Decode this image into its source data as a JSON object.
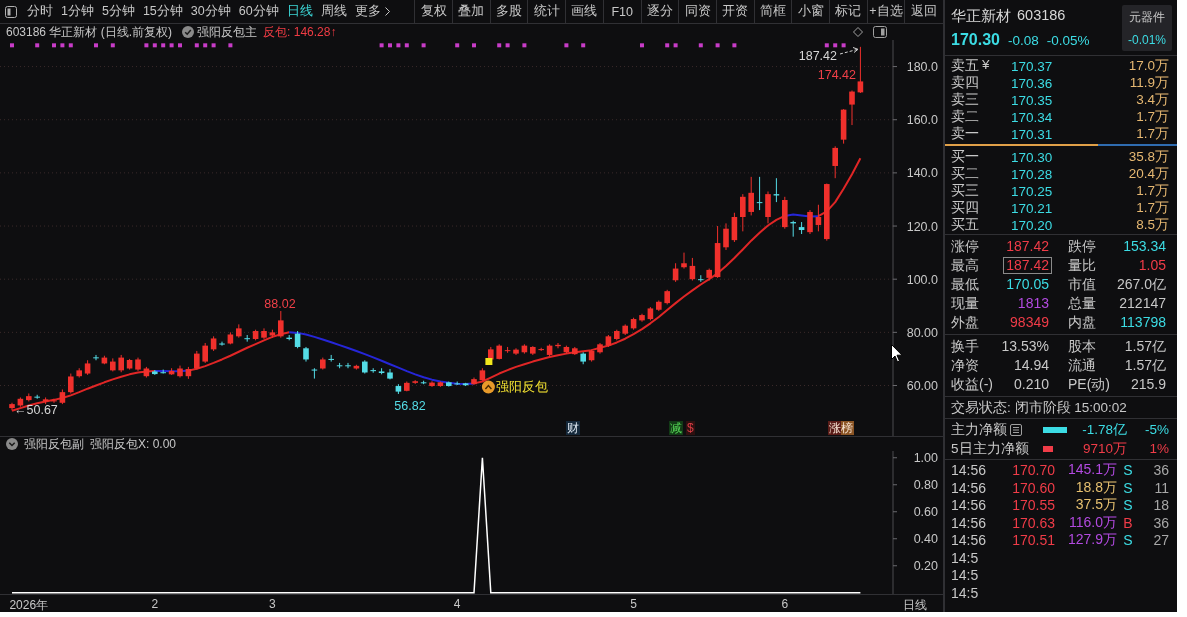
{
  "toolbar": {
    "periods": [
      {
        "label": "分时",
        "selected": false
      },
      {
        "label": "1分钟",
        "selected": false
      },
      {
        "label": "5分钟",
        "selected": false
      },
      {
        "label": "15分钟",
        "selected": false
      },
      {
        "label": "30分钟",
        "selected": false
      },
      {
        "label": "60分钟",
        "selected": false
      },
      {
        "label": "日线",
        "selected": true
      },
      {
        "label": "周线",
        "selected": false
      }
    ],
    "more_label": "更多",
    "actions": [
      "复权",
      "叠加",
      "多股",
      "统计",
      "画线",
      "F10",
      "逐分",
      "同资",
      "开资",
      "简框",
      "小窗",
      "标记",
      "+自选",
      "返回"
    ]
  },
  "chart_header": {
    "title": "603186 华正新材 (日线.前复权)",
    "indicator": "强阳反包主",
    "reading": "反包: 146.28↑"
  },
  "price_pane": {
    "chart_data": [
      {
        "type": "candlestick",
        "ylim": [
          41,
          190
        ],
        "yticks": [
          {
            "value": 60,
            "label": "60.00"
          },
          {
            "value": 80,
            "label": "80.00"
          },
          {
            "value": 100,
            "label": "100.0"
          },
          {
            "value": 120,
            "label": "120.0"
          },
          {
            "value": 140,
            "label": "140.0"
          },
          {
            "value": 160,
            "label": "160.0"
          },
          {
            "value": 180,
            "label": "180.0"
          }
        ],
        "tick_labels": "y",
        "grid": true,
        "ohlc": [
          [
            51.5,
            53.5,
            50.67,
            53
          ],
          [
            52.5,
            55.5,
            52,
            55
          ],
          [
            54.5,
            57,
            54,
            56
          ],
          [
            55.8,
            56.5,
            55,
            55.5
          ],
          [
            54,
            55.5,
            53,
            54.8
          ],
          [
            54.2,
            55,
            53.5,
            54.4
          ],
          [
            53.5,
            58.5,
            53,
            57.5
          ],
          [
            57.5,
            64.5,
            57,
            63.4
          ],
          [
            63.5,
            66.5,
            63,
            65.7
          ],
          [
            64.5,
            69.5,
            64,
            68.3
          ],
          [
            70.6,
            71.5,
            69.5,
            70.3
          ],
          [
            68.3,
            71.2,
            68,
            70.5
          ],
          [
            65.7,
            70.2,
            65.3,
            69
          ],
          [
            65.7,
            71.5,
            65,
            70.5
          ],
          [
            66.4,
            70,
            66,
            69.6
          ],
          [
            66,
            70.5,
            65.5,
            69.8
          ],
          [
            63.5,
            67,
            63,
            66.4
          ],
          [
            65.3,
            65.8,
            64,
            64.3
          ],
          [
            65,
            66,
            64.5,
            64.8
          ],
          [
            64.2,
            66.5,
            64,
            65.5
          ],
          [
            63.5,
            67.5,
            63,
            66.4
          ],
          [
            63.5,
            67,
            62.5,
            66.2
          ],
          [
            66.4,
            73,
            66,
            72
          ],
          [
            69,
            76,
            68.5,
            75
          ],
          [
            73.6,
            78.5,
            73,
            77.7
          ],
          [
            75.8,
            76.5,
            75,
            75.4
          ],
          [
            75.8,
            80,
            75.5,
            79.2
          ],
          [
            78.5,
            83,
            78,
            81.5
          ],
          [
            77.8,
            79,
            76.5,
            77.5
          ],
          [
            77.5,
            81,
            77,
            80.5
          ],
          [
            78,
            81.5,
            77.5,
            80.5
          ],
          [
            78.8,
            81,
            78,
            80
          ],
          [
            78.5,
            88.02,
            78,
            84.5
          ],
          [
            78,
            79,
            77,
            77.5
          ],
          [
            79.5,
            80.5,
            74,
            74.5
          ],
          [
            74,
            74.5,
            69,
            69.8
          ],
          [
            66,
            66.5,
            62.6,
            65.7
          ],
          [
            66.4,
            70.5,
            66,
            69.8
          ],
          [
            70,
            71.5,
            69,
            69.8
          ],
          [
            67.6,
            68.5,
            66.5,
            67.4
          ],
          [
            67.6,
            68.5,
            66.5,
            67.4
          ],
          [
            66.4,
            67.8,
            66,
            67.4
          ],
          [
            69,
            69.5,
            64.5,
            64.9
          ],
          [
            65.8,
            66.5,
            64.8,
            65.4
          ],
          [
            65.3,
            66.5,
            64.2,
            64.7
          ],
          [
            64.9,
            66.2,
            62.3,
            62.6
          ],
          [
            59.8,
            60.5,
            56.82,
            57.7
          ],
          [
            58,
            61.5,
            57.8,
            61
          ],
          [
            61,
            62,
            60.6,
            61.6
          ],
          [
            61.2,
            61.8,
            60.5,
            61
          ],
          [
            59.8,
            61.6,
            59.5,
            61.1
          ],
          [
            59.8,
            61.5,
            59.5,
            61.2
          ],
          [
            61.2,
            61.5,
            59.6,
            59.8
          ],
          [
            60.8,
            61.5,
            60.2,
            60.7
          ],
          [
            60.8,
            61,
            59.8,
            60.1
          ],
          [
            60.5,
            63,
            60.3,
            62.4
          ],
          [
            62,
            66.5,
            61.8,
            65.7
          ],
          [
            69.8,
            74.5,
            69.5,
            73.6
          ],
          [
            70,
            75.5,
            69.8,
            75
          ],
          [
            73,
            74.5,
            72.3,
            73.3
          ],
          [
            72,
            74,
            71.5,
            73.5
          ],
          [
            72.5,
            75.5,
            72,
            75
          ],
          [
            72,
            74.8,
            71.5,
            74.5
          ],
          [
            73.5,
            74.2,
            73,
            73.7
          ],
          [
            71.5,
            75.5,
            71,
            75
          ],
          [
            74.8,
            76,
            74,
            75.3
          ],
          [
            72.5,
            75,
            72,
            74.5
          ],
          [
            71.8,
            74.5,
            71.5,
            74
          ],
          [
            72,
            72.5,
            68,
            69
          ],
          [
            69.5,
            73.5,
            69,
            73
          ],
          [
            72.5,
            76,
            72,
            75.5
          ],
          [
            75,
            79,
            74.5,
            78.5
          ],
          [
            77.5,
            81,
            77,
            80.5
          ],
          [
            79.5,
            83,
            79,
            82.5
          ],
          [
            81.5,
            85.5,
            81,
            85
          ],
          [
            84.5,
            87,
            84,
            86.5
          ],
          [
            85,
            89.5,
            84.5,
            89
          ],
          [
            88.5,
            92,
            88,
            91.5
          ],
          [
            91,
            96,
            90.5,
            95.5
          ],
          [
            99.6,
            106,
            99,
            104
          ],
          [
            104.5,
            110,
            104,
            106
          ],
          [
            100,
            108,
            99.5,
            105
          ],
          [
            100,
            101.5,
            99,
            99.8
          ],
          [
            100.5,
            104,
            99.5,
            103.5
          ],
          [
            100.8,
            120,
            100.5,
            113.6
          ],
          [
            112,
            121,
            111,
            119
          ],
          [
            114.7,
            125,
            114,
            123.4
          ],
          [
            123.4,
            132,
            118,
            131
          ],
          [
            125.3,
            138.5,
            124,
            132.5
          ],
          [
            129,
            138.5,
            126,
            128.7
          ],
          [
            123.4,
            133,
            121,
            132
          ],
          [
            132,
            138,
            129,
            131.5
          ],
          [
            119.6,
            131,
            119,
            129.8
          ],
          [
            121.5,
            122,
            116,
            121
          ],
          [
            119.6,
            121.5,
            117,
            118.5
          ],
          [
            117.7,
            126,
            117,
            125.3
          ],
          [
            120.4,
            128,
            118,
            123.4
          ],
          [
            115.1,
            136,
            114.5,
            135.8
          ],
          [
            142.6,
            150,
            138,
            149.4
          ],
          [
            152.5,
            164,
            151,
            163.8
          ],
          [
            165.7,
            171,
            158,
            170.6
          ],
          [
            170.3,
            187.42,
            170.05,
            174.42
          ]
        ],
        "series": [
          {
            "type": "line",
            "color": "#e02626",
            "values": [
              50.5,
              51.5,
              52.5,
              53.3,
              54,
              54.6,
              55.3,
              56.3,
              57.5,
              58.8,
              60,
              61.2,
              62.3,
              63.3,
              64.2,
              64.9,
              65.3,
              65.5,
              null,
              null,
              null,
              65.6,
              66.3,
              67.3,
              68.5,
              69.8,
              71.2,
              72.7,
              74.2,
              75.6,
              77,
              78.3,
              79.3,
              80,
              null,
              null,
              null,
              null,
              null,
              null,
              null,
              null,
              null,
              null,
              null,
              null,
              null,
              null,
              null,
              null,
              null,
              null,
              null,
              null,
              null,
              60.8,
              61.5,
              63,
              64.5,
              65.8,
              67,
              68,
              69,
              69.9,
              70.7,
              71.4,
              72,
              72.5,
              72.9,
              73.3,
              74.2,
              75,
              76.2,
              77.6,
              79.3,
              81.2,
              83.4,
              85.8,
              88.4,
              91,
              93.5,
              95.8,
              98,
              100,
              102.2,
              105,
              108,
              111.2,
              114.5,
              117.5,
              120.2,
              122.3,
              123.8,
              null,
              null,
              null,
              123.7,
              125.5,
              129,
              134,
              139.5,
              145.5
            ]
          },
          {
            "type": "line",
            "color": "#2626d8",
            "values": [
              null,
              null,
              null,
              null,
              null,
              null,
              null,
              null,
              null,
              null,
              null,
              null,
              null,
              null,
              null,
              null,
              null,
              65.5,
              65.5,
              65.4,
              65.4,
              65.6,
              null,
              null,
              null,
              null,
              null,
              null,
              null,
              null,
              null,
              null,
              null,
              80,
              79.8,
              79.2,
              78.3,
              77.3,
              76.3,
              75.2,
              74.1,
              73,
              71.8,
              70.6,
              69.3,
              68,
              66.7,
              65.4,
              64.2,
              63.1,
              62.2,
              61.5,
              61,
              60.7,
              60.6,
              60.8,
              null,
              null,
              null,
              null,
              null,
              null,
              null,
              null,
              null,
              null,
              null,
              null,
              null,
              null,
              null,
              null,
              null,
              null,
              null,
              null,
              null,
              null,
              null,
              null,
              null,
              null,
              null,
              null,
              null,
              null,
              null,
              null,
              null,
              null,
              null,
              null,
              123.8,
              124.3,
              124,
              123.6,
              123.7,
              null,
              null,
              null,
              null,
              null
            ]
          },
          {
            "type": "scatter",
            "marker": "square",
            "color": "#c83cc8",
            "values": [
              188,
              null,
              null,
              188,
              null,
              188,
              188,
              188,
              null,
              null,
              188,
              null,
              188,
              null,
              null,
              null,
              188,
              188,
              188,
              188,
              188,
              null,
              188,
              188,
              188,
              null,
              188,
              null,
              null,
              null,
              null,
              null,
              null,
              null,
              null,
              null,
              null,
              null,
              null,
              null,
              null,
              null,
              null,
              null,
              188,
              188,
              188,
              188,
              null,
              188,
              null,
              null,
              null,
              188,
              null,
              188,
              null,
              null,
              188,
              188,
              null,
              188,
              null,
              null,
              null,
              null,
              188,
              null,
              188,
              null,
              null,
              null,
              null,
              null,
              null,
              188,
              null,
              null,
              188,
              188,
              null,
              null,
              188,
              null,
              188,
              null,
              188,
              null,
              null,
              null,
              null,
              null,
              null,
              null,
              null,
              null,
              null,
              188,
              188,
              188,
              null,
              null
            ]
          }
        ],
        "annotations": [
          "←50.67",
          "88.02",
          "56.82",
          "187.42",
          "174.42"
        ]
      }
    ],
    "signal_label": "强阳反包",
    "events": [
      {
        "label": "财",
        "kind": "finance"
      },
      {
        "label": "减",
        "kind": "reduce"
      },
      {
        "label": "$",
        "kind": "dividend"
      },
      {
        "label": "涨榜",
        "kind": "rank"
      }
    ]
  },
  "indicator_pane": {
    "title": "强阳反包副",
    "reading": "强阳反包X: 0.00",
    "axis_caption": "日线",
    "chart_data": [
      {
        "type": "line",
        "color": "#ffffff",
        "ylim": [
          0,
          1.05
        ],
        "yticks": [
          {
            "value": 0.2,
            "label": "0.20"
          },
          {
            "value": 0.4,
            "label": "0.40"
          },
          {
            "value": 0.6,
            "label": "0.60"
          },
          {
            "value": 0.8,
            "label": "0.80"
          },
          {
            "value": 1,
            "label": "1.00"
          }
        ],
        "categories": [
          null,
          null,
          "2026年",
          null,
          null,
          null,
          null,
          null,
          null,
          null,
          null,
          null,
          null,
          null,
          null,
          null,
          null,
          "2",
          null,
          null,
          null,
          null,
          null,
          null,
          null,
          null,
          null,
          null,
          null,
          null,
          null,
          "3",
          null,
          null,
          null,
          null,
          null,
          null,
          null,
          null,
          null,
          null,
          null,
          null,
          null,
          null,
          null,
          null,
          null,
          null,
          null,
          null,
          null,
          "4",
          null,
          null,
          null,
          null,
          null,
          null,
          null,
          null,
          null,
          null,
          null,
          null,
          null,
          null,
          null,
          null,
          null,
          null,
          null,
          null,
          "5",
          null,
          null,
          null,
          null,
          null,
          null,
          null,
          null,
          null,
          null,
          null,
          null,
          null,
          null,
          null,
          null,
          null,
          "6",
          null,
          null,
          null,
          null,
          null,
          null,
          null,
          null,
          null
        ],
        "values": [
          0,
          0,
          0,
          0,
          0,
          0,
          0,
          0,
          0,
          0,
          0,
          0,
          0,
          0,
          0,
          0,
          0,
          0,
          0,
          0,
          0,
          0,
          0,
          0,
          0,
          0,
          0,
          0,
          0,
          0,
          0,
          0,
          0,
          0,
          0,
          0,
          0,
          0,
          0,
          0,
          0,
          0,
          0,
          0,
          0,
          0,
          0,
          0,
          0,
          0,
          0,
          0,
          0,
          0,
          0,
          0,
          1,
          0,
          0,
          0,
          0,
          0,
          0,
          0,
          0,
          0,
          0,
          0,
          0,
          0,
          0,
          0,
          0,
          0,
          0,
          0,
          0,
          0,
          0,
          0,
          0,
          0,
          0,
          0,
          0,
          0,
          0,
          0,
          0,
          0,
          0,
          0,
          0,
          0,
          0,
          0,
          0,
          0,
          0,
          0,
          0,
          0
        ]
      }
    ]
  },
  "quote_panel": {
    "name": "华正新材",
    "code": "603186",
    "price": "170.30",
    "change": "-0.08",
    "change_pct": "-0.05%",
    "falling": true,
    "sector": {
      "name": "元器件",
      "change": "-0.01%",
      "falling": true
    },
    "asks": [
      {
        "label": "卖五",
        "marker": "¥",
        "price": "170.37",
        "volume": "17.0万"
      },
      {
        "label": "卖四",
        "price": "170.36",
        "volume": "11.9万"
      },
      {
        "label": "卖三",
        "price": "170.35",
        "volume": "3.4万"
      },
      {
        "label": "卖二",
        "price": "170.34",
        "volume": "1.7万"
      },
      {
        "label": "卖一",
        "price": "170.31",
        "volume": "1.7万"
      }
    ],
    "balance": {
      "level": 0.66
    },
    "bids": [
      {
        "label": "买一",
        "price": "170.30",
        "volume": "35.8万"
      },
      {
        "label": "买二",
        "price": "170.28",
        "volume": "20.4万"
      },
      {
        "label": "买三",
        "price": "170.25",
        "volume": "1.7万"
      },
      {
        "label": "买四",
        "price": "170.21",
        "volume": "1.7万"
      },
      {
        "label": "买五",
        "price": "170.20",
        "volume": "8.5万"
      }
    ],
    "stats": [
      {
        "label": "涨停",
        "value": "187.42",
        "kind": "up",
        "highlighted": false
      },
      {
        "label": "跌停",
        "value": "153.34",
        "kind": "down",
        "highlighted": false
      },
      {
        "label": "最高",
        "value": "187.42",
        "kind": "up",
        "highlighted": true
      },
      {
        "label": "量比",
        "value": "1.05",
        "kind": "up",
        "highlighted": false
      },
      {
        "label": "最低",
        "value": "170.05",
        "kind": "down",
        "highlighted": false
      },
      {
        "label": "市值",
        "value": "267.0亿",
        "kind": "plain",
        "highlighted": false
      },
      {
        "label": "现量",
        "value": "1813",
        "kind": "volume",
        "highlighted": false
      },
      {
        "label": "总量",
        "value": "212147",
        "kind": "plain",
        "highlighted": false
      },
      {
        "label": "外盘",
        "value": "98349",
        "kind": "up",
        "highlighted": false
      },
      {
        "label": "内盘",
        "value": "113798",
        "kind": "down",
        "highlighted": false
      }
    ],
    "fundamentals": [
      {
        "label": "换手",
        "value": "13.53%"
      },
      {
        "label": "股本",
        "value": "1.57亿"
      },
      {
        "label": "净资",
        "value": "14.94"
      },
      {
        "label": "流通",
        "value": "1.57亿"
      },
      {
        "label": "收益(-)",
        "value": "0.210"
      },
      {
        "label": "PE(动)",
        "value": "215.9"
      }
    ],
    "trade_status": "交易状态: 闭市阶段 15:00:02",
    "flows": [
      {
        "label": "主力净额",
        "menu_icon": true,
        "value": "-1.78亿",
        "pct": "-5%",
        "kind": "outflow"
      },
      {
        "label": "5日主力净额",
        "menu_icon": false,
        "value": "9710万",
        "pct": "1%",
        "kind": "inflow"
      }
    ],
    "ticks": [
      {
        "time": "14:56",
        "price": "170.70",
        "volume": "145.1万",
        "large": true,
        "side": "S",
        "kind": "sell",
        "count": "36"
      },
      {
        "time": "14:56",
        "price": "170.60",
        "volume": "18.8万",
        "large": false,
        "side": "S",
        "kind": "sell",
        "count": "11"
      },
      {
        "time": "14:56",
        "price": "170.55",
        "volume": "37.5万",
        "large": false,
        "side": "S",
        "kind": "sell",
        "count": "18"
      },
      {
        "time": "14:56",
        "price": "170.63",
        "volume": "116.0万",
        "large": true,
        "side": "B",
        "kind": "buy",
        "count": "36"
      },
      {
        "time": "14:56",
        "price": "170.51",
        "volume": "127.9万",
        "large": true,
        "side": "S",
        "kind": "sell",
        "count": "27"
      },
      {
        "time": "14:5"
      },
      {
        "time": "14:5"
      },
      {
        "time": "14:5"
      }
    ]
  }
}
